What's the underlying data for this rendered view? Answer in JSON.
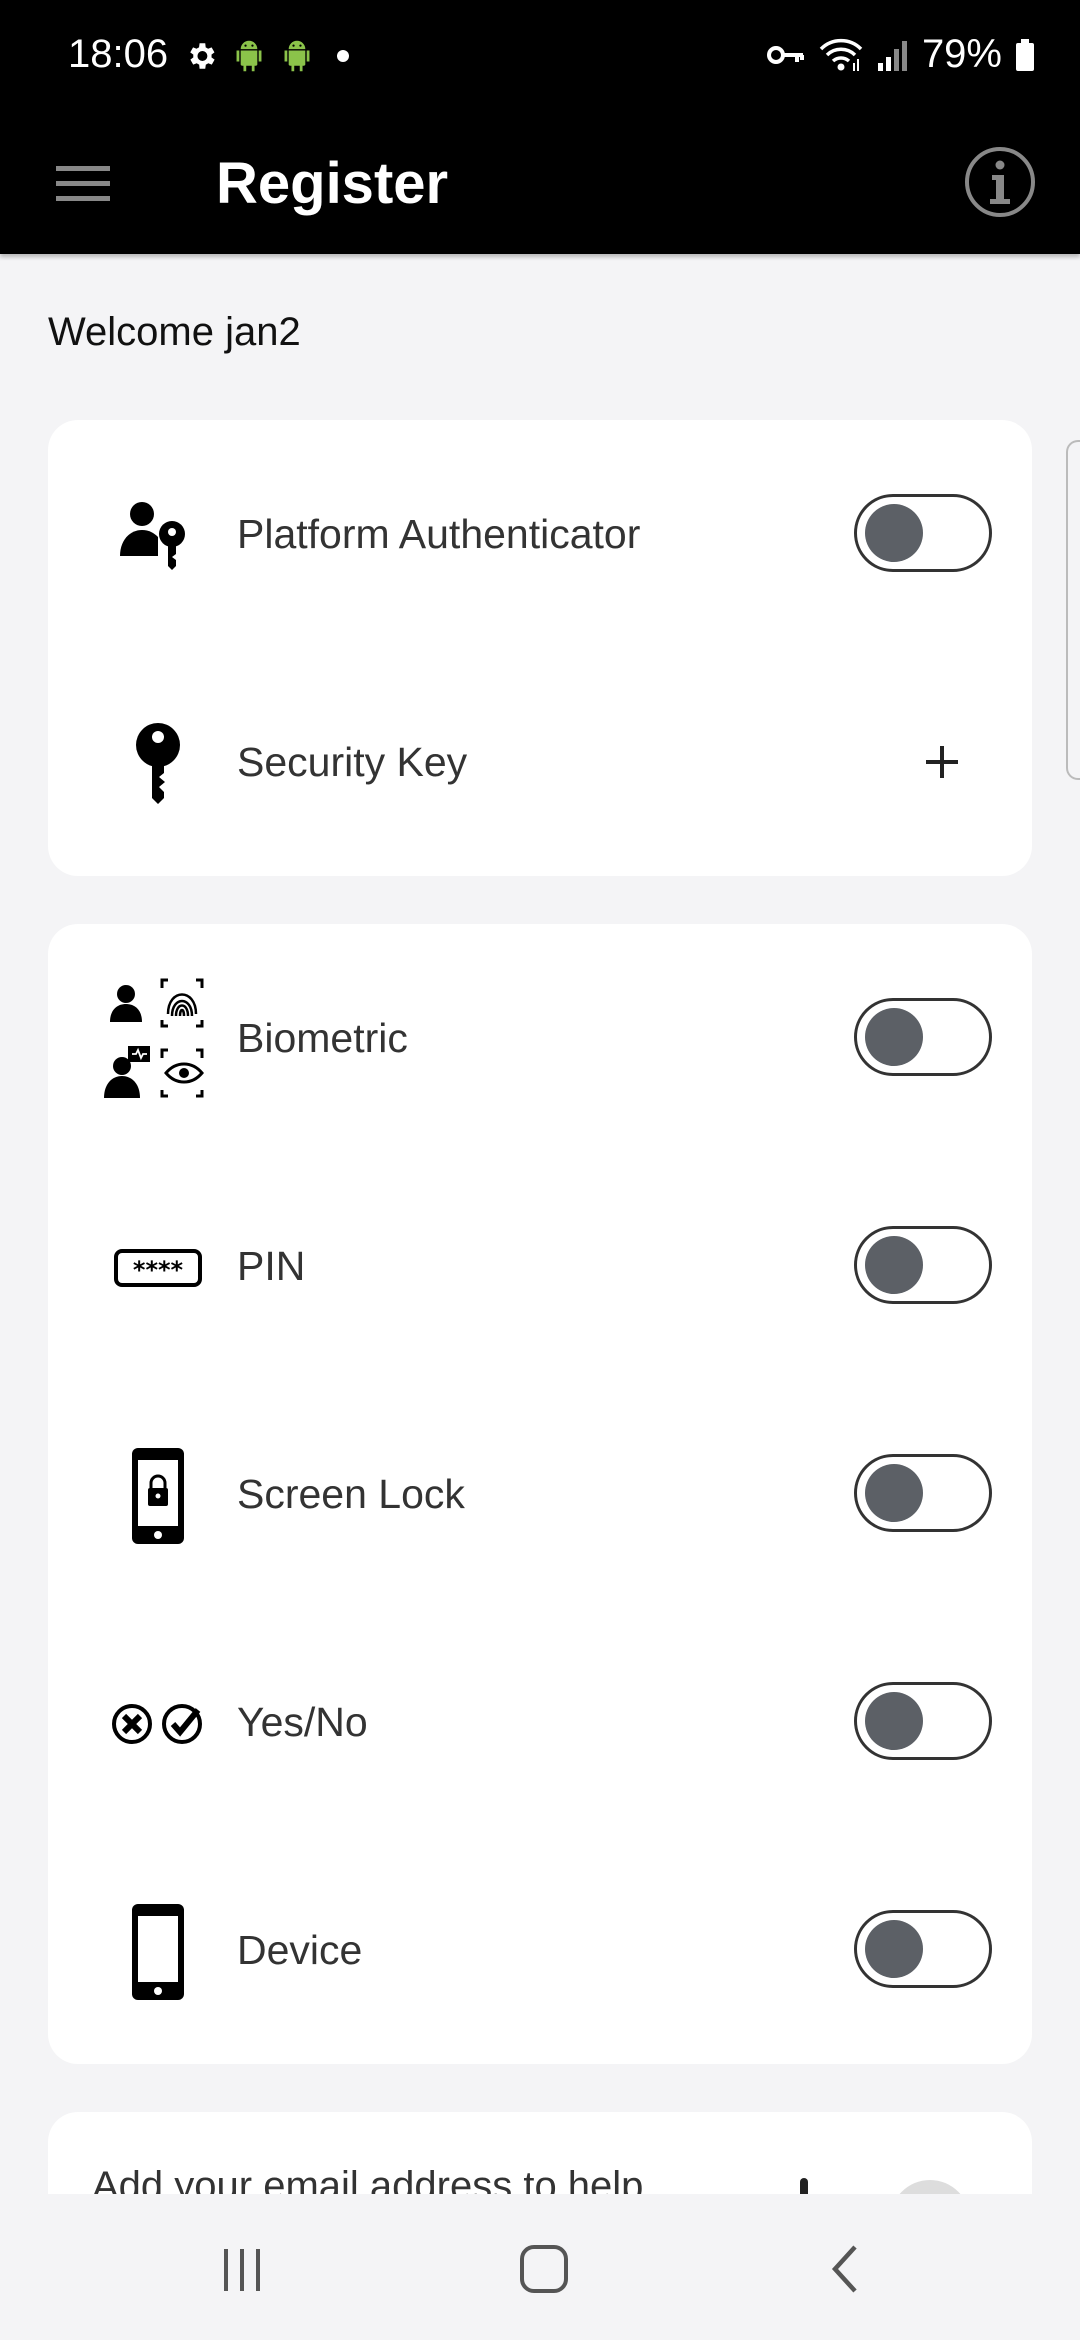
{
  "status_bar": {
    "time": "18:06",
    "battery": "79%",
    "icons": [
      "settings-icon",
      "android-icon",
      "android-icon",
      "dot-icon",
      "vpn-key-icon",
      "wifi-icon",
      "signal-icon",
      "battery-icon"
    ]
  },
  "app_bar": {
    "title": "Register",
    "menu_icon": "hamburger-menu-icon",
    "info_icon": "info-icon"
  },
  "welcome_text": "Welcome jan2",
  "groups": [
    {
      "items": [
        {
          "label": "Platform Authenticator",
          "icon": "person-key-icon",
          "control": "toggle",
          "on": false
        },
        {
          "label": "Security Key",
          "icon": "key-icon",
          "control": "add",
          "on": false
        }
      ]
    },
    {
      "items": [
        {
          "label": "Biometric",
          "icon": "biometric-icon",
          "control": "toggle",
          "on": false
        },
        {
          "label": "PIN",
          "icon": "pin-icon",
          "control": "toggle",
          "on": false
        },
        {
          "label": "Screen Lock",
          "icon": "screen-lock-icon",
          "control": "toggle",
          "on": false
        },
        {
          "label": "Yes/No",
          "icon": "yes-no-icon",
          "control": "toggle",
          "on": false
        },
        {
          "label": "Device",
          "icon": "phone-icon",
          "control": "toggle",
          "on": false
        }
      ]
    }
  ],
  "email_card": {
    "text": "Add your email address to help"
  },
  "nav_bar": {
    "recents_icon": "recents-icon",
    "home_icon": "home-icon",
    "back_icon": "back-icon"
  },
  "colors": {
    "app_bar": "#000000",
    "background": "#f4f4f6",
    "card": "#ffffff",
    "toggle_knob": "#5c6066",
    "android_green": "#8bc34a"
  }
}
